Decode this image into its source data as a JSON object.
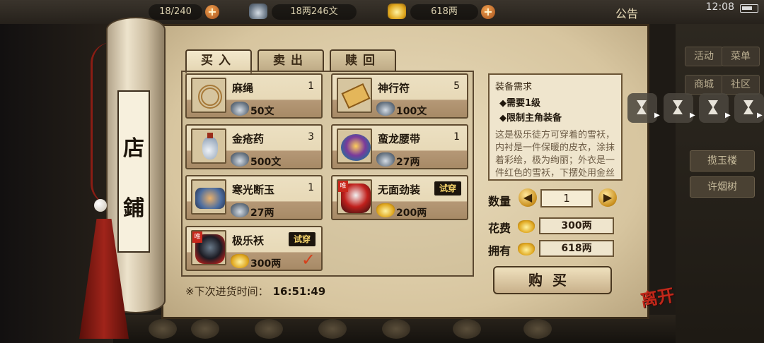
{
  "topbar": {
    "bag": "18/240",
    "money": "18两246文",
    "gold": "618两",
    "notice": "公告",
    "time": "12:08"
  },
  "scroll": {
    "title_char1": "店",
    "title_char2": "鋪"
  },
  "tabs": [
    {
      "label": "买入",
      "active": true
    },
    {
      "label": "卖出",
      "active": false
    },
    {
      "label": "赎回",
      "active": false
    }
  ],
  "items": [
    {
      "name": "麻绳",
      "qty": "1",
      "price": "50文",
      "currency": "silver"
    },
    {
      "name": "神行符",
      "qty": "5",
      "price": "100文",
      "currency": "silver"
    },
    {
      "name": "金疮药",
      "qty": "3",
      "price": "500文",
      "currency": "silver"
    },
    {
      "name": "蛮龙腰带",
      "qty": "1",
      "price": "27两",
      "currency": "silver"
    },
    {
      "name": "寒光断玉",
      "qty": "1",
      "price": "27两",
      "currency": "silver"
    },
    {
      "name": "无面劲装",
      "try": "试穿",
      "price": "200两",
      "currency": "gold",
      "unique": "唯"
    },
    {
      "name": "极乐袄",
      "try": "试穿",
      "price": "300两",
      "currency": "gold",
      "unique": "唯",
      "selected": true
    }
  ],
  "restock": {
    "label": "※下次进货时间：",
    "time": "16:51:49"
  },
  "description": {
    "title": "装备需求",
    "req1": "◆需要1级",
    "req2": "◆限制主角装备",
    "body": "这是极乐徒方可穿着的雪袄，内衬是一件保暖的皮衣，涂抹着彩绘，极为绚丽；外衣是一件红色的雪袄，下摆处用金丝编织着"
  },
  "purchase": {
    "qty_label": "数量",
    "qty_value": "1",
    "cost_label": "花费",
    "cost_value": "300两",
    "own_label": "拥有",
    "own_value": "618两",
    "buy_label": "购买"
  },
  "right_panel": {
    "btn_activity": "活动",
    "btn_menu": "菜单",
    "btn_shop": "商城",
    "btn_community": "社区",
    "btn_place1": "揽玉楼",
    "btn_place2": "许烟树"
  },
  "leave_label": "离开"
}
